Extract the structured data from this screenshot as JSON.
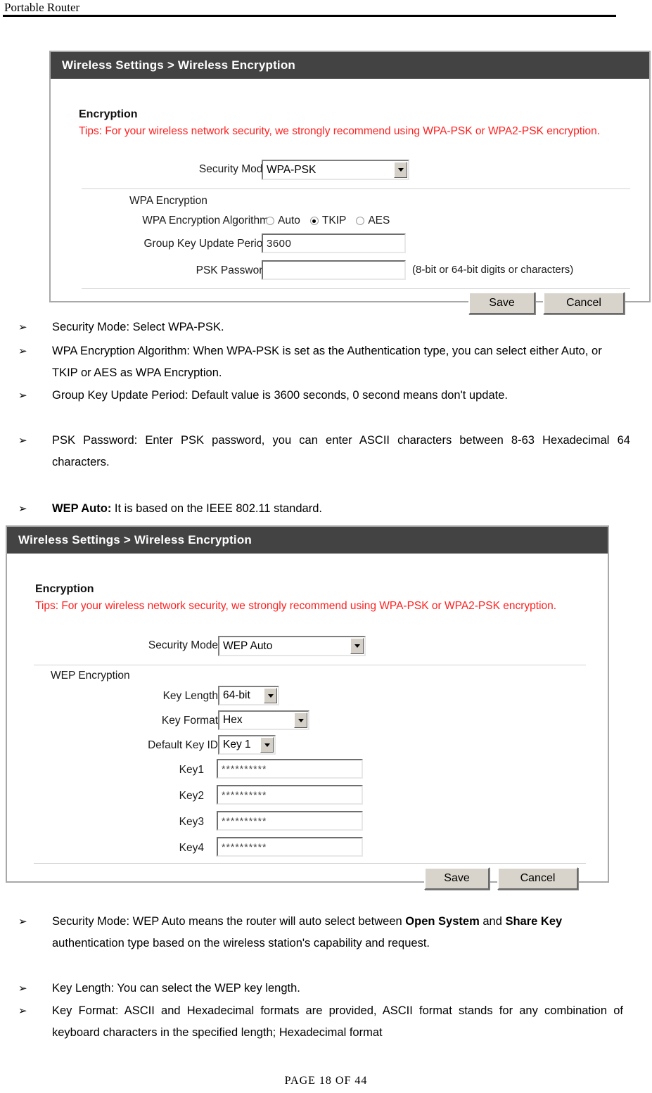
{
  "document": {
    "running_header": "Portable Router",
    "footer": "PAGE  18  OF  44"
  },
  "panel_wpa": {
    "titlebar": "Wireless Settings > Wireless Encryption",
    "section_title": "Encryption",
    "tips": "Tips: For your wireless network security, we strongly recommend using WPA-PSK or WPA2-PSK encryption.",
    "security_mode_label": "Security Mode",
    "security_mode_value": "WPA-PSK",
    "wpa_encryption_label": "WPA Encryption",
    "algorithm_label": "WPA Encryption Algorithm",
    "algorithm_options": [
      {
        "label": "Auto",
        "selected": false
      },
      {
        "label": "TKIP",
        "selected": true
      },
      {
        "label": "AES",
        "selected": false
      }
    ],
    "group_key_label": "Group Key Update Period",
    "group_key_value": "3600",
    "psk_password_label": "PSK Password",
    "psk_password_value": "",
    "psk_password_hint": "(8-bit or 64-bit digits or characters)",
    "save_label": "Save",
    "cancel_label": "Cancel"
  },
  "list_wpa": [
    "Security Mode: Select WPA-PSK.",
    "WPA Encryption Algorithm: When WPA-PSK is set as the Authentication type, you can select either Auto, or TKIP or AES as WPA Encryption.",
    "Group Key Update Period: Default value is 3600 seconds, 0 second means don't update.",
    "PSK Password: Enter PSK password, you can enter ASCII characters between 8-63 Hexadecimal 64 characters."
  ],
  "wep_auto_heading": {
    "bold_part": "WEP Auto:",
    "rest": " It is based on the IEEE 802.11 standard."
  },
  "panel_wep": {
    "titlebar": "Wireless Settings > Wireless Encryption",
    "section_title": "Encryption",
    "tips": "Tips: For your wireless network security, we strongly recommend using WPA-PSK or WPA2-PSK encryption.",
    "security_mode_label": "Security Mode",
    "security_mode_value": "WEP Auto",
    "wep_encryption_label": "WEP Encryption",
    "key_length_label": "Key Length",
    "key_length_value": "64-bit",
    "key_format_label": "Key Format",
    "key_format_value": "Hex",
    "default_key_id_label": "Default Key ID",
    "default_key_id_value": "Key 1",
    "keys": [
      {
        "label": "Key1",
        "value": "**********"
      },
      {
        "label": "Key2",
        "value": "**********"
      },
      {
        "label": "Key3",
        "value": "**********"
      },
      {
        "label": "Key4",
        "value": "**********"
      }
    ],
    "save_label": "Save",
    "cancel_label": "Cancel"
  },
  "list_wep": {
    "item1_pre": "Security Mode: WEP Auto means the router will auto select between ",
    "item1_bold1": "Open System",
    "item1_mid": " and ",
    "item1_bold2": "Share Key",
    "item1_post": " authentication type based on the wireless station's capability and request.",
    "item2": "Key Length: You can select the WEP key length.",
    "item3": "Key Format: ASCII and Hexadecimal formats are provided, ASCII format stands for any combination of keyboard characters in the specified length; Hexadecimal format"
  },
  "icons": {
    "bullet_mark": "➢",
    "dropdown_caret": "caret-down-icon"
  }
}
